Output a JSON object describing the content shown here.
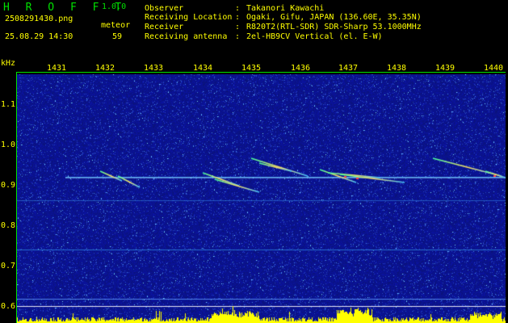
{
  "header": {
    "app_title": "H R O F F T",
    "version": "1.0.0",
    "filename": "2508291430.png",
    "datetime": "25.08.29 14:30",
    "detection_label": "meteor",
    "detection_count": "59"
  },
  "info": [
    {
      "label": "Observer",
      "sep": ":",
      "value": "Takanori Kawachi"
    },
    {
      "label": "Receiving Location",
      "sep": ":",
      "value": "Ogaki, Gifu, JAPAN (136.60E, 35.35N)"
    },
    {
      "label": "Receiver",
      "sep": ":",
      "value": "R820T2(RTL-SDR) SDR-Sharp 53.1000MHz"
    },
    {
      "label": "Receiving antenna",
      "sep": ":",
      "value": "2el-HB9CV Vertical (el. E-W)"
    }
  ],
  "axes": {
    "y_unit": "kHz",
    "x_ticks": [
      "1431",
      "1432",
      "1433",
      "1434",
      "1435",
      "1436",
      "1437",
      "1438",
      "1439",
      "1440"
    ],
    "y_ticks": [
      "1.1",
      "1.0",
      "0.9",
      "0.8",
      "0.7",
      "0.6"
    ]
  },
  "colors": {
    "text_green": "#00e000",
    "text_yellow": "#ffff00",
    "background_noise": "#10189a",
    "signal_line": "#60c0ff",
    "level_bars": "#ffff00"
  }
}
